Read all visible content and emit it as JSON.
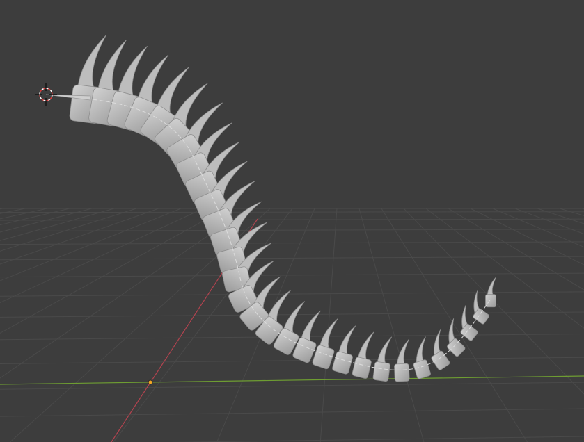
{
  "viewport": {
    "view": "3d-viewport",
    "background_color": "#3d3d3d",
    "grid_color": "#4a4a4a",
    "x_axis_color": "#b3434f",
    "y_axis_color": "#6e9d32",
    "bone_color": "#bdbdbd",
    "bone_shadow_color": "#8e8e8e",
    "armature_color": "#dcdcdc"
  },
  "scene": {
    "objects": [
      {
        "name": "3d-cursor",
        "icon": "crosshair-icon"
      },
      {
        "name": "world-origin",
        "icon": "origin-dot-icon"
      },
      {
        "name": "spine-mesh"
      },
      {
        "name": "armature-bone-chain"
      }
    ]
  }
}
